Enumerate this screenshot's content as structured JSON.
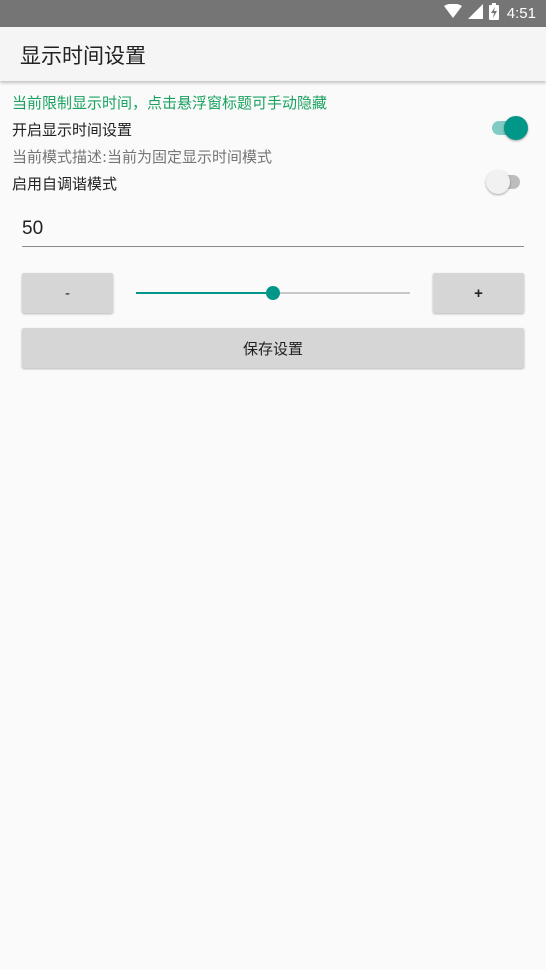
{
  "status_bar": {
    "time": "4:51",
    "icons": [
      "wifi-icon",
      "cell-signal-icon",
      "battery-charging-icon"
    ]
  },
  "app_bar": {
    "title": "显示时间设置"
  },
  "hint": "当前限制显示时间，点击悬浮窗标题可手动隐藏",
  "display_time_setting": {
    "label": "开启显示时间设置",
    "enabled": true
  },
  "mode_description": "当前模式描述:当前为固定显示时间模式",
  "auto_tune_mode": {
    "label": "启用自调谐模式",
    "enabled": false
  },
  "value_input": {
    "value": "50"
  },
  "stepper": {
    "minus_label": "-",
    "plus_label": "+",
    "slider_fraction": 0.5
  },
  "save_button": {
    "label": "保存设置"
  },
  "colors": {
    "accent": "#009688",
    "hint_green": "#1aa260",
    "status_bar": "#757575",
    "button_bg": "#d6d6d6"
  }
}
